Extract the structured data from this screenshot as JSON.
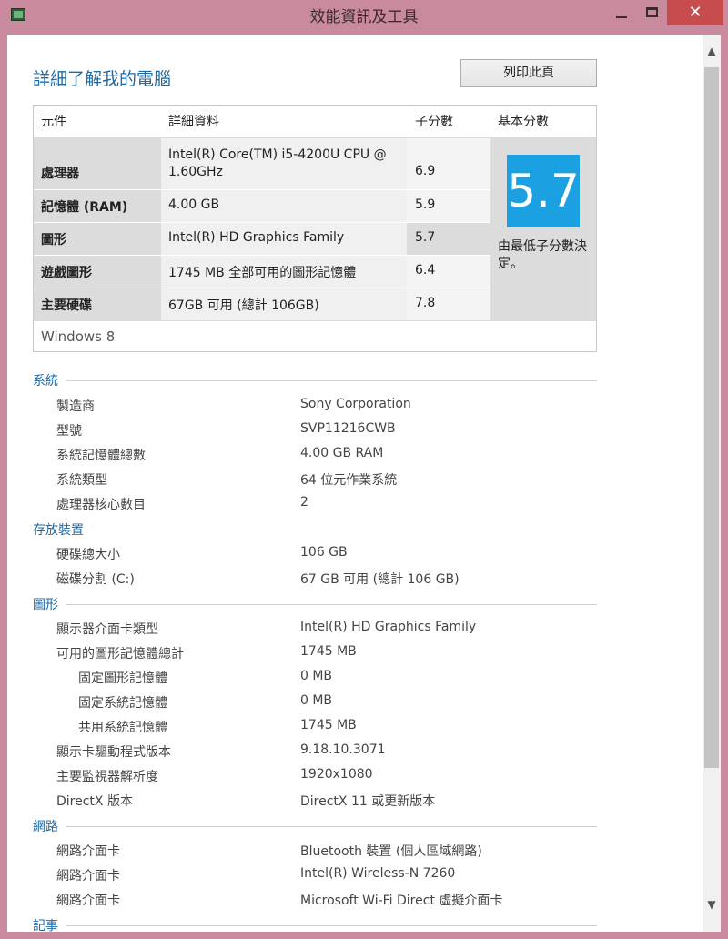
{
  "window": {
    "title": "效能資訊及工具",
    "close_glyph": "✕",
    "scroll_up_glyph": "▲",
    "scroll_down_glyph": "▼"
  },
  "header": {
    "title": "詳細了解我的電腦",
    "print_label": "列印此頁"
  },
  "score_table": {
    "columns": [
      "元件",
      "詳細資料",
      "子分數",
      "基本分數"
    ],
    "rows": [
      {
        "component": "處理器",
        "detail": "Intel(R) Core(TM) i5-4200U CPU @ 1.60GHz",
        "subscore": "6.9"
      },
      {
        "component": "記憶體 (RAM)",
        "detail": "4.00 GB",
        "subscore": "5.9"
      },
      {
        "component": "圖形",
        "detail": "Intel(R) HD Graphics Family",
        "subscore": "5.7"
      },
      {
        "component": "遊戲圖形",
        "detail": "1745 MB 全部可用的圖形記憶體",
        "subscore": "6.4"
      },
      {
        "component": "主要硬碟",
        "detail": "67GB 可用 (總計 106GB)",
        "subscore": "7.8"
      }
    ],
    "base_score": "5.7",
    "base_note": "由最低子分數決定。",
    "os": "Windows 8",
    "score_color": "#1ba1e2"
  },
  "sections": {
    "system": {
      "title": "系統",
      "items": [
        {
          "label": "製造商",
          "value": "Sony Corporation"
        },
        {
          "label": "型號",
          "value": "SVP11216CWB"
        },
        {
          "label": "系統記憶體總數",
          "value": "4.00 GB RAM"
        },
        {
          "label": "系統類型",
          "value": "64 位元作業系統"
        },
        {
          "label": "處理器核心數目",
          "value": "2"
        }
      ]
    },
    "storage": {
      "title": "存放裝置",
      "items": [
        {
          "label": "硬碟總大小",
          "value": "106 GB"
        },
        {
          "label": "磁碟分割 (C:)",
          "value": "67 GB 可用 (總計 106 GB)"
        }
      ]
    },
    "graphics": {
      "title": "圖形",
      "items": [
        {
          "label": "顯示器介面卡類型",
          "value": "Intel(R) HD Graphics Family"
        },
        {
          "label": "可用的圖形記憶體總計",
          "value": "1745 MB"
        },
        {
          "label": "固定圖形記憶體",
          "value": "0 MB"
        },
        {
          "label": "固定系統記憶體",
          "value": "0 MB"
        },
        {
          "label": "共用系統記憶體",
          "value": "1745 MB"
        },
        {
          "label": "顯示卡驅動程式版本",
          "value": "9.18.10.3071"
        },
        {
          "label": "主要監視器解析度",
          "value": "1920x1080"
        },
        {
          "label": "DirectX 版本",
          "value": "DirectX 11 或更新版本"
        }
      ]
    },
    "network": {
      "title": "網路",
      "items": [
        {
          "label": "網路介面卡",
          "value": "Bluetooth 裝置 (個人區域網路)"
        },
        {
          "label": "網路介面卡",
          "value": "Intel(R) Wireless-N 7260"
        },
        {
          "label": "網路介面卡",
          "value": "Microsoft Wi-Fi Direct 虛擬介面卡"
        }
      ]
    },
    "notes": {
      "title": "記事"
    }
  }
}
